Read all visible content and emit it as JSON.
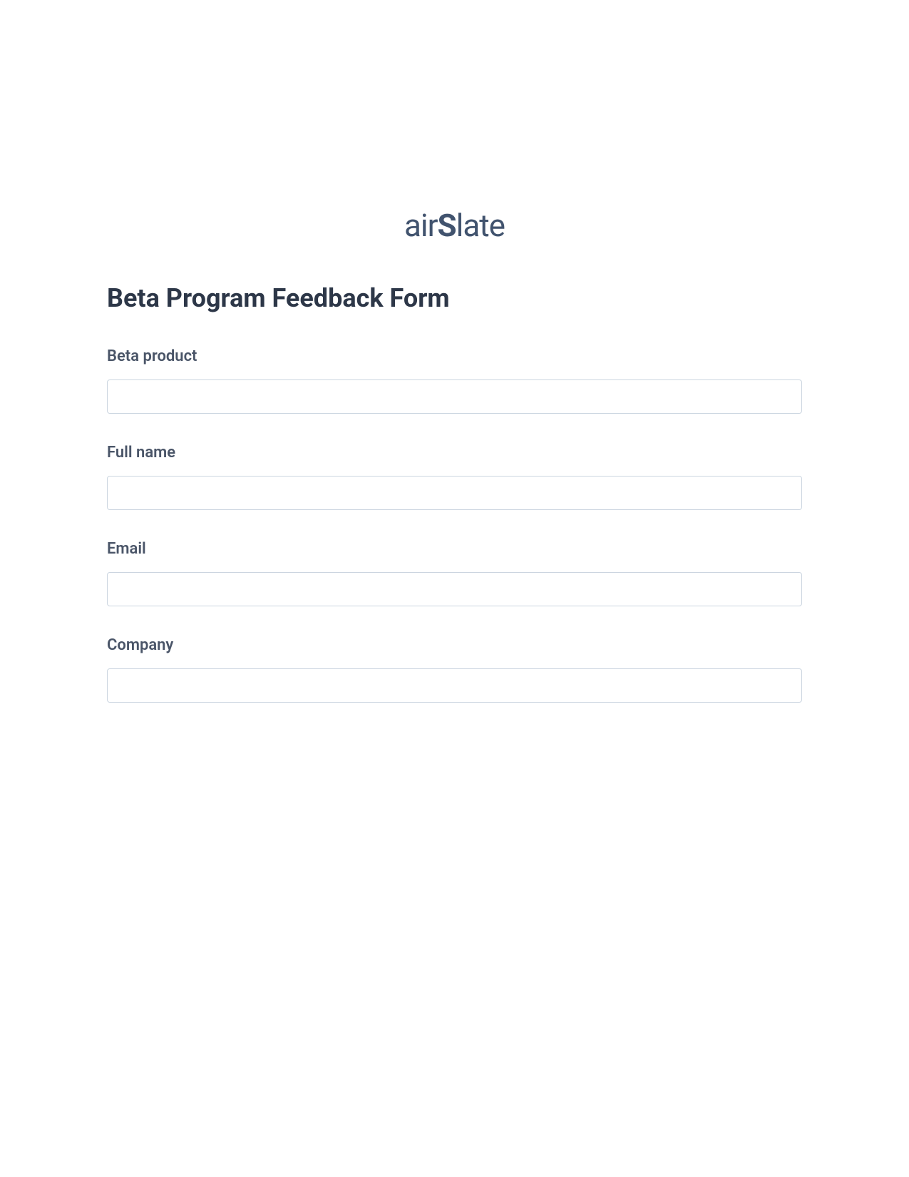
{
  "logo": {
    "text": "airSlate"
  },
  "form": {
    "title": "Beta Program Feedback Form",
    "fields": [
      {
        "label": "Beta product",
        "value": ""
      },
      {
        "label": "Full name",
        "value": ""
      },
      {
        "label": "Email",
        "value": ""
      },
      {
        "label": "Company",
        "value": ""
      }
    ]
  }
}
